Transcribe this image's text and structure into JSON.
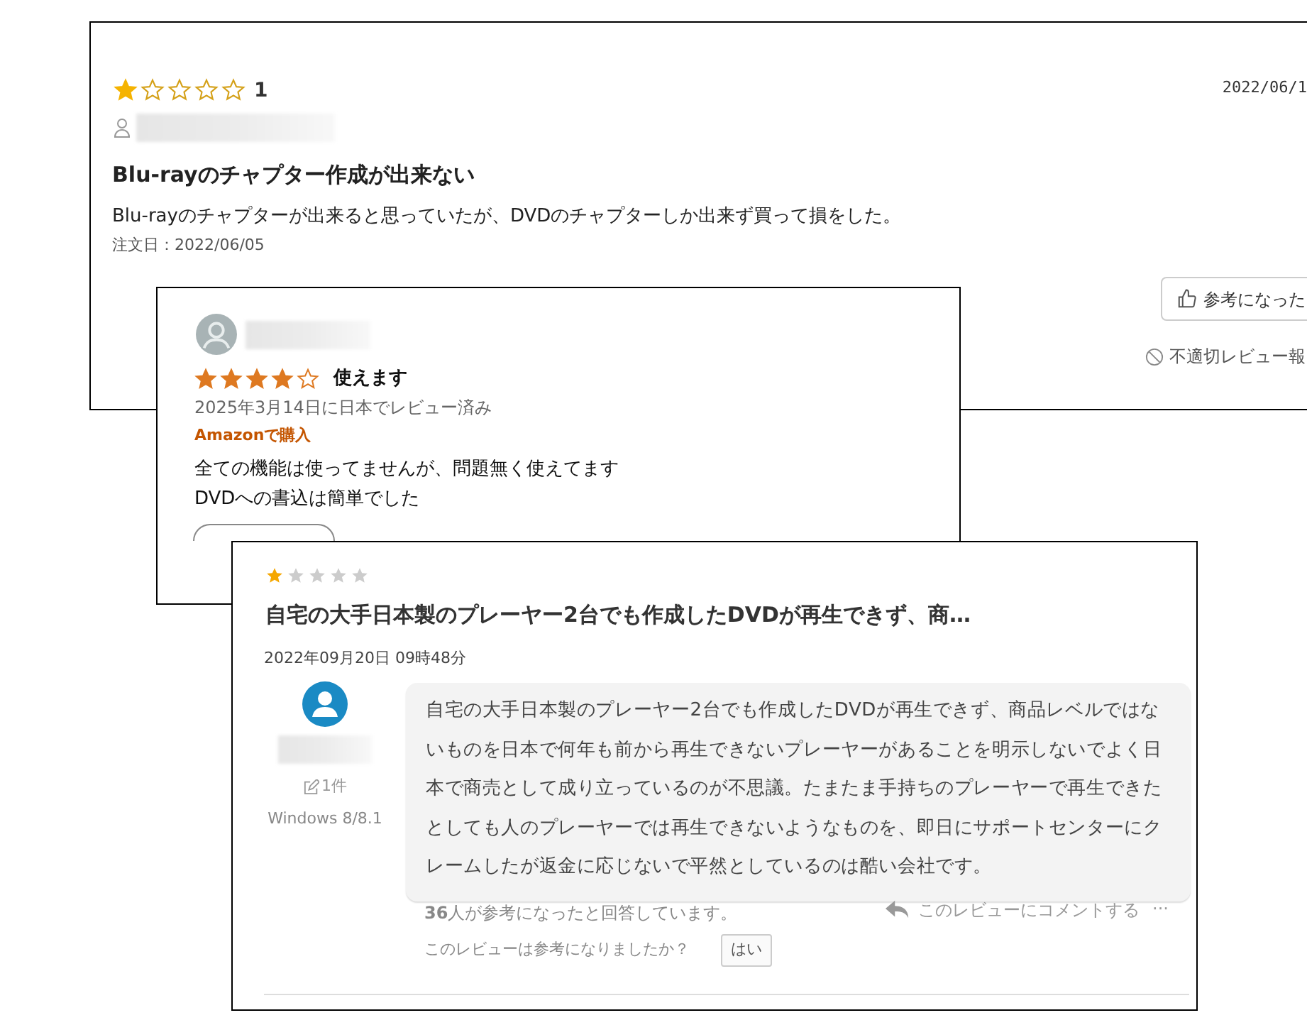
{
  "reviews": [
    {
      "kind": "shop",
      "stars": 1,
      "rating_text": "1",
      "date": "2022/06/1",
      "title": "Blu-rayのチャプター作成が出来ない",
      "body": "Blu-rayのチャプターが出来ると思っていたが、DVDのチャプターしか出来ず買って損をした。",
      "order_date": "注文日：2022/06/05",
      "helpful_button": "参考になった",
      "report_link": "不適切レビュー報"
    },
    {
      "kind": "amazon",
      "stars": 4,
      "title": "使えます",
      "date": "2025年3月14日に日本でレビュー済み",
      "badge": "Amazonで購入",
      "body_lines": [
        "全ての機能は使ってませんが、問題無く使えてます",
        "DVDへの書込は簡単でした"
      ]
    },
    {
      "kind": "forum",
      "stars": 1,
      "title": "自宅の大手日本製のプレーヤー2台でも作成したDVDが再生できず、商…",
      "date": "2022年09月20日 09時48分",
      "review_count": "1件",
      "os": "Windows 8/8.1",
      "body": "自宅の大手日本製のプレーヤー2台でも作成したDVDが再生できず、商品レベルではないものを日本で何年も前から再生できないプレーヤーがあることを明示しないでよく日本で商売として成り立っているのが不思議。たまたま手持ちのプレーヤーで再生できたとしても人のプレーヤーでは再生できないようなものを、即日にサポートセンターにクレームしたが返金に応じないで平然としているのは酷い会社です。",
      "helpful_count": "**36**人が参考になったと回答しています。",
      "comment_link": "このレビューにコメントする",
      "more": "···",
      "question": "このレビューは参考になりましたか？",
      "yes_button": "はい"
    }
  ]
}
